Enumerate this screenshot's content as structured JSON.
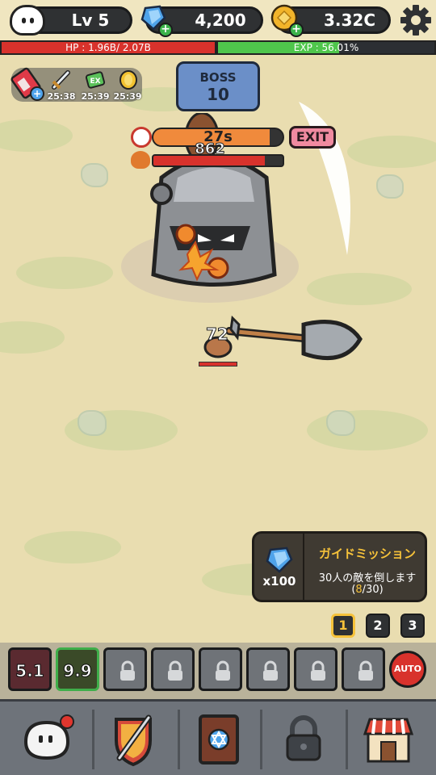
{
  "player": {
    "level_label": "Lv 5",
    "gems": "4,200",
    "gold": "3.32C"
  },
  "bars": {
    "hp_label": "HP : 1.96B/ 2.07B",
    "hp_fraction": 0.947,
    "exp_label": "EXP : 56.01%",
    "exp_fraction": 0.5601
  },
  "buffs": [
    {
      "icon": "sword-icon",
      "time": "25:38"
    },
    {
      "icon": "exp-scroll-icon",
      "time": "25:39"
    },
    {
      "icon": "gold-coin-icon",
      "time": "25:39"
    }
  ],
  "boss": {
    "badge_label": "BOSS",
    "stage": "10",
    "timer": "27s",
    "timer_fraction": 0.9,
    "hp_value": "862",
    "hp_fraction": 0.86,
    "exit_label": "EXIT"
  },
  "hero": {
    "level": "72"
  },
  "mission": {
    "reward": "x100",
    "title": "ガイドミッション",
    "description": "30人の敵を倒します",
    "progress_open": "(",
    "progress_current": "8",
    "progress_rest": "/30)"
  },
  "pages": [
    "1",
    "2",
    "3"
  ],
  "skills": [
    {
      "type": "skill",
      "value": "5.1"
    },
    {
      "type": "skill",
      "value": "9.9"
    },
    {
      "type": "locked"
    },
    {
      "type": "locked"
    },
    {
      "type": "locked"
    },
    {
      "type": "locked"
    },
    {
      "type": "locked"
    },
    {
      "type": "locked"
    }
  ],
  "auto_label": "AUTO",
  "nav": [
    {
      "icon": "character-icon"
    },
    {
      "icon": "equipment-shield-icon"
    },
    {
      "icon": "spellbook-icon"
    },
    {
      "icon": "lock-icon"
    },
    {
      "icon": "shop-icon"
    }
  ],
  "colors": {
    "hp": "#d8322c",
    "exp": "#4fc64c",
    "timer": "#f08a3c",
    "accent": "#f6c23a"
  }
}
